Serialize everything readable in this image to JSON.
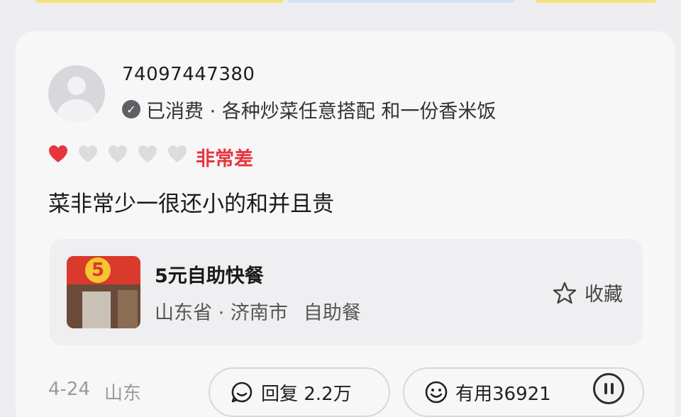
{
  "review": {
    "username": "74097447380",
    "consumed_label": "已消费 · 各种炒菜任意搭配 和一份香米饭",
    "rating": {
      "value": 1,
      "max": 5,
      "label": "非常差"
    },
    "text": "菜非常少一很还小的和并且贵"
  },
  "shop": {
    "name": "5元自助快餐",
    "location": "山东省 · 济南市",
    "category": "自助餐",
    "thumb_number": "5",
    "collect_label": "收藏"
  },
  "footer": {
    "date": "4-24",
    "region": "山东",
    "reply_label": "回复 2.2万",
    "useful_label": "有用36921"
  },
  "colors": {
    "accent_red": "#e8343f",
    "heart_empty": "#dcdcdf"
  },
  "icons": [
    "verified-check-icon",
    "heart-icon",
    "star-icon",
    "smile-icon",
    "more-icon"
  ]
}
